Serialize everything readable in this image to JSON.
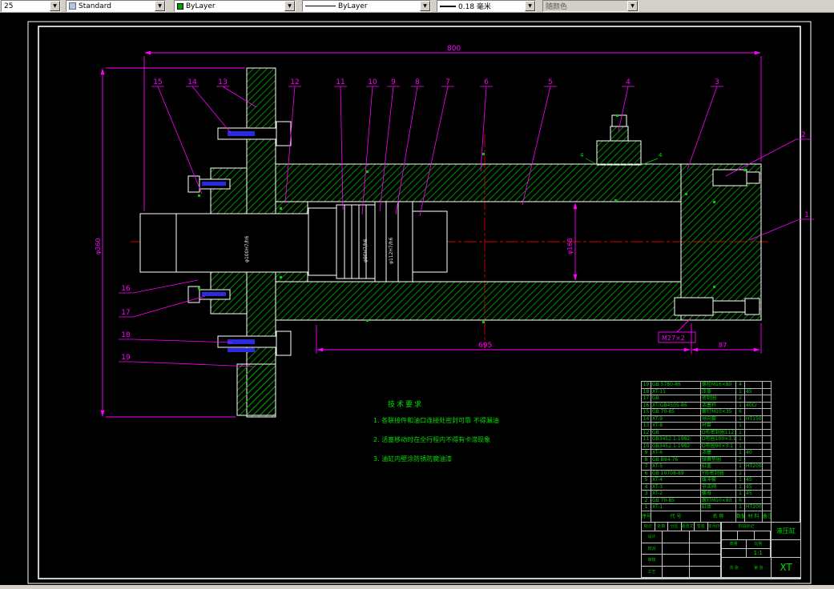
{
  "toolbar": {
    "layer": "25",
    "style": "Standard",
    "color": "ByLayer",
    "linetype": "ByLayer",
    "lineweight": "0.18 毫米",
    "plotstyle": "随颜色"
  },
  "drawing": {
    "dims": {
      "top": "800",
      "bottom": "695",
      "right": "87",
      "flange": "φ360",
      "bore": "φ168",
      "plug": "M27×2",
      "fit1": "φ100H7/h6",
      "fit2": "φ90H7/h6",
      "fit3": "φ112H7/h6"
    },
    "welds": [
      "4",
      "4"
    ],
    "balloons": [
      "1",
      "2",
      "3",
      "4",
      "5",
      "6",
      "7",
      "8",
      "9",
      "10",
      "11",
      "12",
      "13",
      "14",
      "15",
      "16",
      "17",
      "18",
      "19"
    ],
    "notes": {
      "title": "技术要求",
      "items": [
        "1. 各联接件和油口连接处密封可靠 不得漏油",
        "2. 活塞移动时在全行程内不得有卡滞现象",
        "3. 油缸内壁涂防锈防腐油漆"
      ]
    }
  },
  "bom": {
    "headers": [
      "序号",
      "代  号",
      "名  称",
      "数量",
      "材 料",
      "备注"
    ],
    "rows": [
      {
        "no": "19",
        "code": "GB 5780-86",
        "name": "螺栓M16×80",
        "qty": "4",
        "mat": "",
        "rem": ""
      },
      {
        "no": "18",
        "code": "XT-11",
        "name": "压盖",
        "qty": "1",
        "mat": "45",
        "rem": ""
      },
      {
        "no": "17",
        "code": "GB",
        "name": "密封圈",
        "qty": "2",
        "mat": "",
        "rem": ""
      },
      {
        "no": "16",
        "code": "XT/GB4505-86",
        "name": "活塞杆",
        "qty": "1",
        "mat": "40Cr",
        "rem": ""
      },
      {
        "no": "15",
        "code": "GB 70-85",
        "name": "螺钉M10×35",
        "qty": "6",
        "mat": "",
        "rem": ""
      },
      {
        "no": "14",
        "code": "XT-9",
        "name": "导向套",
        "qty": "1",
        "mat": "HT150",
        "rem": ""
      },
      {
        "no": "13",
        "code": "XT-8",
        "name": "衬套",
        "qty": "1",
        "mat": "",
        "rem": ""
      },
      {
        "no": "12",
        "code": "GB",
        "name": "O形密封圈112×3",
        "qty": "1",
        "mat": "",
        "rem": ""
      },
      {
        "no": "11",
        "code": "GB3452.1-1982",
        "name": "O形圈100×3.1",
        "qty": "1",
        "mat": "",
        "rem": ""
      },
      {
        "no": "10",
        "code": "GB3452.1-1982",
        "name": "O形圈90×3.1",
        "qty": "1",
        "mat": "",
        "rem": ""
      },
      {
        "no": "9",
        "code": "XT-6",
        "name": "活塞",
        "qty": "1",
        "mat": "40",
        "rem": ""
      },
      {
        "no": "8",
        "code": "GB B94-76",
        "name": "弹簧垫圈",
        "qty": "2",
        "mat": "",
        "rem": ""
      },
      {
        "no": "7",
        "code": "XT-5",
        "name": "缸盖",
        "qty": "1",
        "mat": "HT200",
        "rem": ""
      },
      {
        "no": "6",
        "code": "GB 10708-89",
        "name": "Y形密封圈",
        "qty": "2",
        "mat": "",
        "rem": ""
      },
      {
        "no": "5",
        "code": "XT-4",
        "name": "缓冲套",
        "qty": "1",
        "mat": "45",
        "rem": ""
      },
      {
        "no": "4",
        "code": "XT-3",
        "name": "节流阀",
        "qty": "1",
        "mat": "45",
        "rem": ""
      },
      {
        "no": "3",
        "code": "XT-2",
        "name": "螺母",
        "qty": "1",
        "mat": "45",
        "rem": ""
      },
      {
        "no": "2",
        "code": "GB 70-85",
        "name": "螺钉M10×80",
        "qty": "6",
        "mat": "",
        "rem": ""
      },
      {
        "no": "1",
        "code": "XT-1",
        "name": "缸体",
        "qty": "1",
        "mat": "HT200",
        "rem": ""
      }
    ]
  },
  "titleblock": {
    "part": "液压缸",
    "code": "XT",
    "stage_label": "阶段标记",
    "qty_label": "数量",
    "scale_label": "比例",
    "scale": "1:1",
    "sheets": "共 张",
    "sheet_no": "第 张",
    "rev_headers": [
      "标记",
      "处数",
      "分区",
      "更改文件号",
      "签名",
      "年月日"
    ],
    "roles": [
      "设计",
      "校对",
      "审核",
      "工艺"
    ]
  }
}
